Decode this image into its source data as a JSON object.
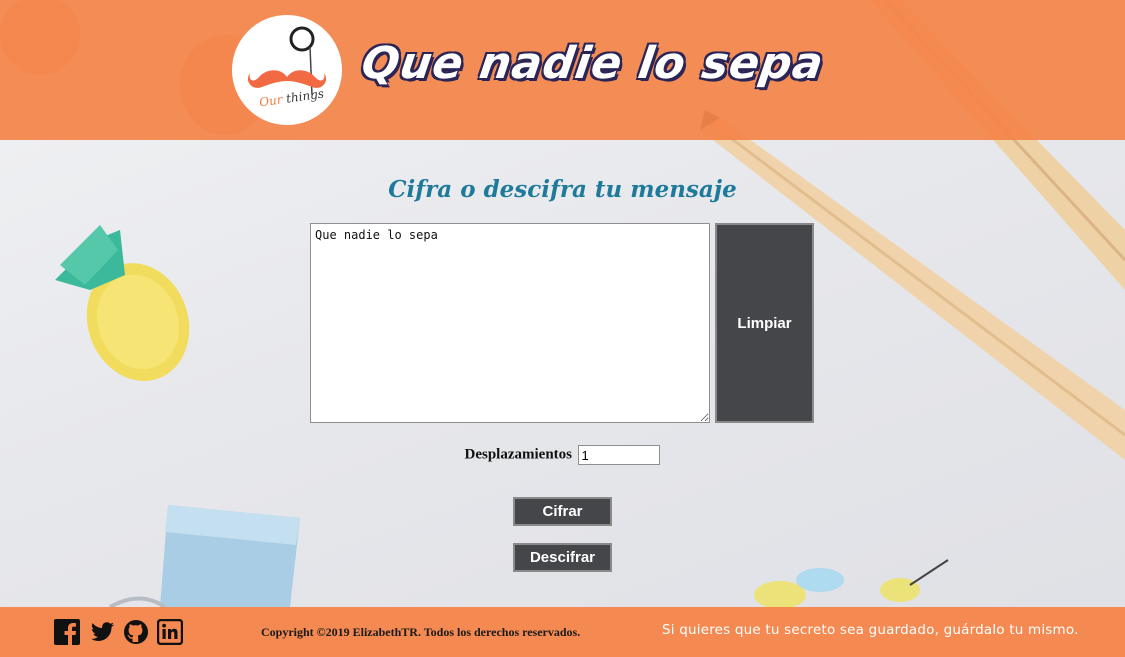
{
  "header": {
    "title": "Que nadie lo sepa",
    "logo_text_our": "Our",
    "logo_text_things": "things"
  },
  "main": {
    "heading": "Cifra o descifra tu mensaje",
    "message_value": "Que nadie lo sepa",
    "clear_label": "Limpiar",
    "shift_label": "Desplazamientos",
    "shift_value": "1",
    "encrypt_label": "Cifrar",
    "decrypt_label": "Descifrar"
  },
  "footer": {
    "social_icons": [
      "facebook-icon",
      "twitter-icon",
      "github-icon",
      "linkedin-icon"
    ],
    "copyright": "Copyright ©2019 ElizabethTR. Todos los derechos reservados.",
    "motto": "Si quieres que tu secreto sea guardado, guárdalo tu mismo."
  },
  "colors": {
    "header_bg": "#f4844a",
    "footer_bg": "#f4844a",
    "heading": "#1e7a9a",
    "button_bg": "#454649",
    "title_outline": "#2b2556"
  }
}
